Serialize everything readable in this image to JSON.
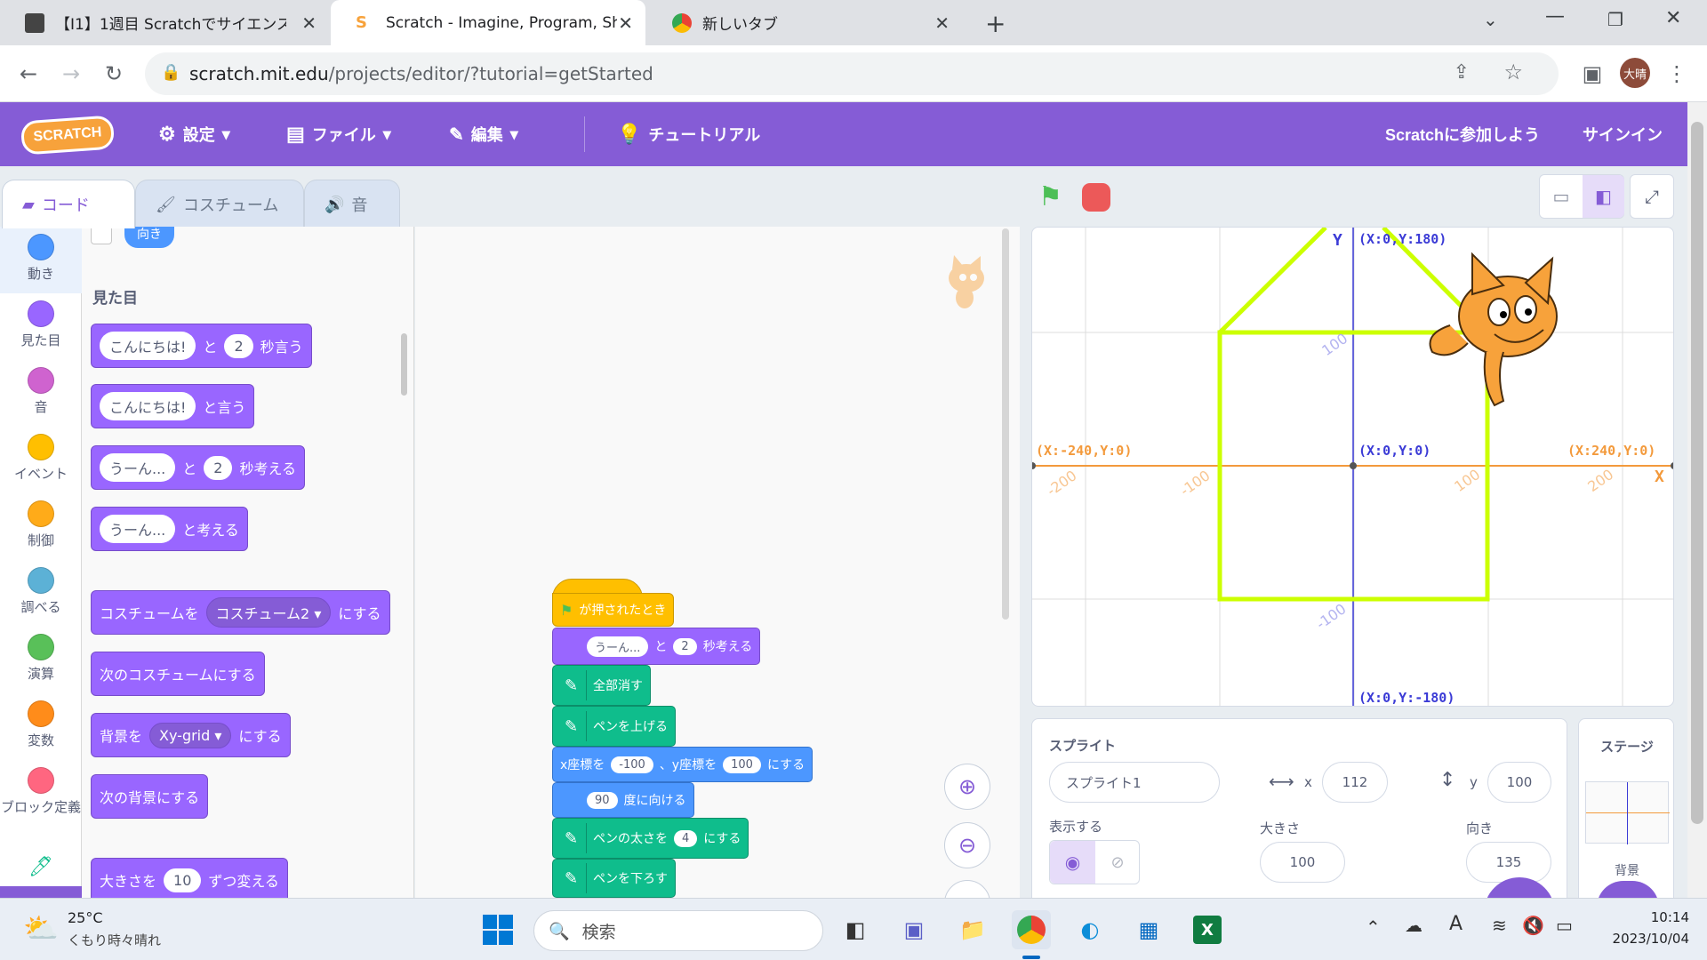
{
  "browser": {
    "tabs": [
      {
        "title": "【I1】1週目 Scratchでサイエンスアー"
      },
      {
        "title": "Scratch - Imagine, Program, Sha"
      },
      {
        "title": "新しいタブ"
      }
    ],
    "url_host": "scratch.mit.edu",
    "url_path": "/projects/editor/?tutorial=getStarted",
    "profile_label": "大晴"
  },
  "menu": {
    "logo": "SCRATCH",
    "settings": "設定",
    "file": "ファイル",
    "edit": "編集",
    "tutorial": "チュートリアル",
    "join": "Scratchに参加しよう",
    "signin": "サインイン"
  },
  "editor_tabs": {
    "code": "コード",
    "costume": "コスチューム",
    "sound": "音"
  },
  "categories": [
    {
      "label": "動き",
      "color": "#4c97ff"
    },
    {
      "label": "見た目",
      "color": "#9966ff"
    },
    {
      "label": "音",
      "color": "#cf63cf"
    },
    {
      "label": "イベント",
      "color": "#ffbf00"
    },
    {
      "label": "制御",
      "color": "#ffab19"
    },
    {
      "label": "調べる",
      "color": "#5cb1d6"
    },
    {
      "label": "演算",
      "color": "#59c059"
    },
    {
      "label": "変数",
      "color": "#ff8c1a"
    },
    {
      "label": "ブロック定義",
      "color": "#ff6680"
    }
  ],
  "palette": {
    "partial_top": "向き",
    "section_title": "見た目",
    "say_secs": {
      "msg": "こんにちは!",
      "and": "と",
      "secs": "2",
      "suffix": "秒言う"
    },
    "say": {
      "msg": "こんにちは!",
      "suffix": "と言う"
    },
    "think_secs": {
      "msg": "うーん...",
      "and": "と",
      "secs": "2",
      "suffix": "秒考える"
    },
    "think": {
      "msg": "うーん...",
      "suffix": "と考える"
    },
    "switch_costume": {
      "prefix": "コスチュームを",
      "value": "コスチューム2",
      "suffix": "にする"
    },
    "next_costume": "次のコスチュームにする",
    "switch_backdrop": {
      "prefix": "背景を",
      "value": "Xy-grid",
      "suffix": "にする"
    },
    "next_backdrop": "次の背景にする",
    "change_size": {
      "prefix": "大きさを",
      "value": "10",
      "suffix": "ずつ変える"
    }
  },
  "script": {
    "hat": "が押されたとき",
    "think": {
      "msg": "うーん...",
      "and": "と",
      "secs": "2",
      "suffix": "秒考える"
    },
    "clear": "全部消す",
    "pen_up": "ペンを上げる",
    "goto": {
      "x_label": "x座標を",
      "x": "-100",
      "sep": "、y座標を",
      "y": "100",
      "suffix": "にする"
    },
    "point": {
      "value": "90",
      "suffix": "度に向ける"
    },
    "pen_size": {
      "prefix": "ペンの太さを",
      "value": "4",
      "suffix": "にする"
    },
    "pen_down": "ペンを下ろす"
  },
  "stage": {
    "y_axis_label": "Y",
    "x_axis_label": "X",
    "top": "(X:0,Y:180)",
    "bottom": "(X:0,Y:-180)",
    "left": "(X:-240,Y:0)",
    "right": "(X:240,Y:0)",
    "center": "(X:0,Y:0)",
    "tick_x_neg200": "-200",
    "tick_x_neg100": "-100",
    "tick_x_100": "100",
    "tick_x_200": "200",
    "tick_y_100": "100",
    "tick_y_neg100": "-100"
  },
  "sprite_info": {
    "title": "スプライト",
    "name": "スプライト1",
    "x_label": "x",
    "x": "112",
    "y_label": "y",
    "y": "100",
    "show_label": "表示する",
    "size_label": "大きさ",
    "size": "100",
    "direction_label": "向き",
    "direction": "135"
  },
  "stage_info": {
    "title": "ステージ",
    "backdrop_label": "背景"
  },
  "taskbar": {
    "temp": "25°C",
    "weather": "くもり時々晴れ",
    "search_placeholder": "検索",
    "time": "10:14",
    "date": "2023/10/04"
  }
}
